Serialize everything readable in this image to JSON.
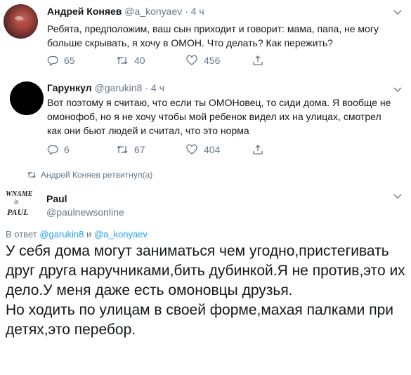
{
  "tweet1": {
    "name": "Андрей Коняев",
    "handle": "@a_konyaev",
    "time": "· 4 ч",
    "text": "Ребята, предположим, ваш сын приходит и говорит: мама, папа, не могу больше скрывать, я хочу в ОМОН. Что делать? Как пережить?",
    "replies": "65",
    "retweets": "40",
    "likes": "456"
  },
  "tweet2": {
    "name": "Гарункул",
    "handle": "@garukin8",
    "time": "· 4 ч",
    "text": "Вот поэтому я считаю, что если ты ОМОНовец, то сиди дома. Я вообще не омонофоб, но я не хочу чтобы мой ребенок видел их на улицах, смотрел как они бьют людей и считал, что это норма",
    "replies": "6",
    "retweets": "67",
    "likes": "404"
  },
  "retweet_note": "Андрей Коняев ретвитнул(а)",
  "tweet3": {
    "name": "Paul",
    "handle": "@paulnewsonline",
    "reply_prefix": "В ответ",
    "reply_user1": "@garukin8",
    "reply_and": "и",
    "reply_user2": "@a_konyaev",
    "text": "У себя дома могут заниматься чем угодно,пристегивать друг друга наручниками,бить дубинкой.Я не против,это их дело.У меня даже есть омоновцы друзья.\nНо ходить по улицам в своей форме,махая палками при детях,это перебор.",
    "avatar_text_top": "WNAME",
    "avatar_text_mid": "is",
    "avatar_text_bottom": "PAUL"
  },
  "colors": {
    "text": "#14171a",
    "secondary": "#657786",
    "link": "#1da1f2",
    "divider": "#ccd6dd"
  }
}
